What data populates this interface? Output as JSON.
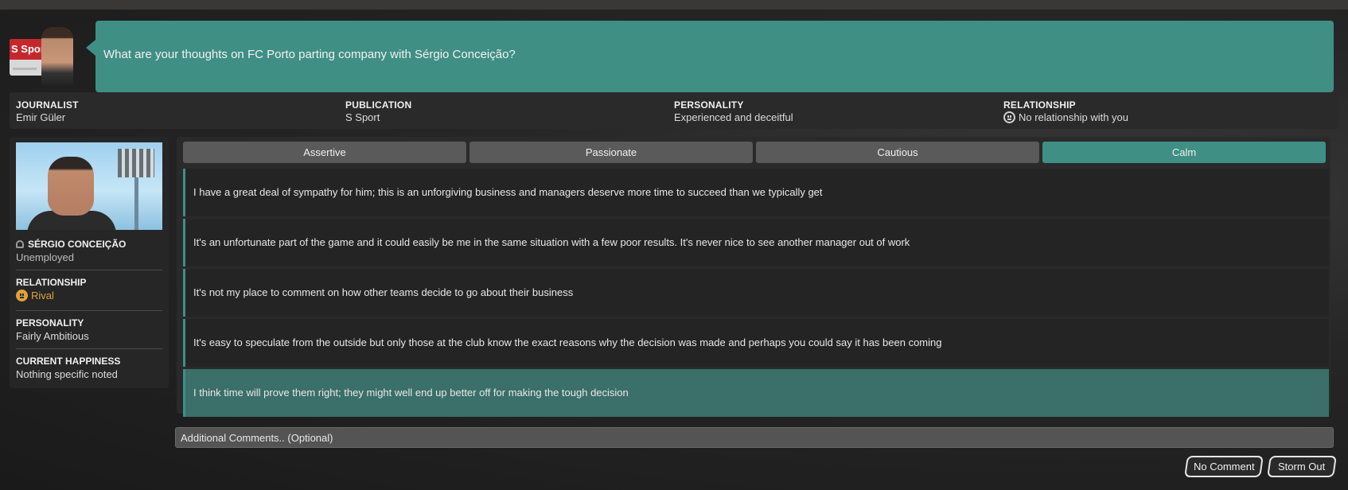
{
  "question": {
    "publication_logo_text": "S Sport",
    "text": "What are your thoughts on FC Porto parting company with Sérgio Conceição?"
  },
  "info": {
    "journalist_label": "JOURNALIST",
    "journalist_value": "Emir Güler",
    "publication_label": "PUBLICATION",
    "publication_value": "S Sport",
    "personality_label": "PERSONALITY",
    "personality_value": "Experienced and deceitful",
    "relationship_label": "RELATIONSHIP",
    "relationship_value": "No relationship with you"
  },
  "manager": {
    "name": "SÉRGIO CONCEIÇÃO",
    "status": "Unemployed",
    "relationship_label": "RELATIONSHIP",
    "relationship_value": "Rival",
    "personality_label": "PERSONALITY",
    "personality_value": "Fairly Ambitious",
    "happiness_label": "CURRENT HAPPINESS",
    "happiness_value": "Nothing specific noted"
  },
  "tones": [
    {
      "label": "Assertive",
      "active": false
    },
    {
      "label": "Passionate",
      "active": false
    },
    {
      "label": "Cautious",
      "active": false
    },
    {
      "label": "Calm",
      "active": true
    }
  ],
  "answers": [
    {
      "text": "I have a great deal of sympathy for him; this is an unforgiving business and managers deserve more time to succeed than we typically get",
      "selected": false
    },
    {
      "text": "It's an unfortunate part of the game and it could easily be me in the same situation with a few poor results. It's never nice to see another manager out of work",
      "selected": false
    },
    {
      "text": "It's not my place to comment on how other teams decide to go about their business",
      "selected": false
    },
    {
      "text": "It's easy to speculate from the outside but only those at the club know the exact reasons why the decision was made and perhaps you could say it has been coming",
      "selected": false
    },
    {
      "text": "I think time will prove them right; they might well end up better off for making the tough decision",
      "selected": true
    }
  ],
  "comments": {
    "placeholder": "Additional Comments.. (Optional)",
    "value": ""
  },
  "buttons": {
    "no_comment": "No Comment",
    "storm_out": "Storm Out"
  },
  "colors": {
    "accent": "#3f8f84",
    "rival": "#e0a23a",
    "panel": "#2a2a2a"
  }
}
